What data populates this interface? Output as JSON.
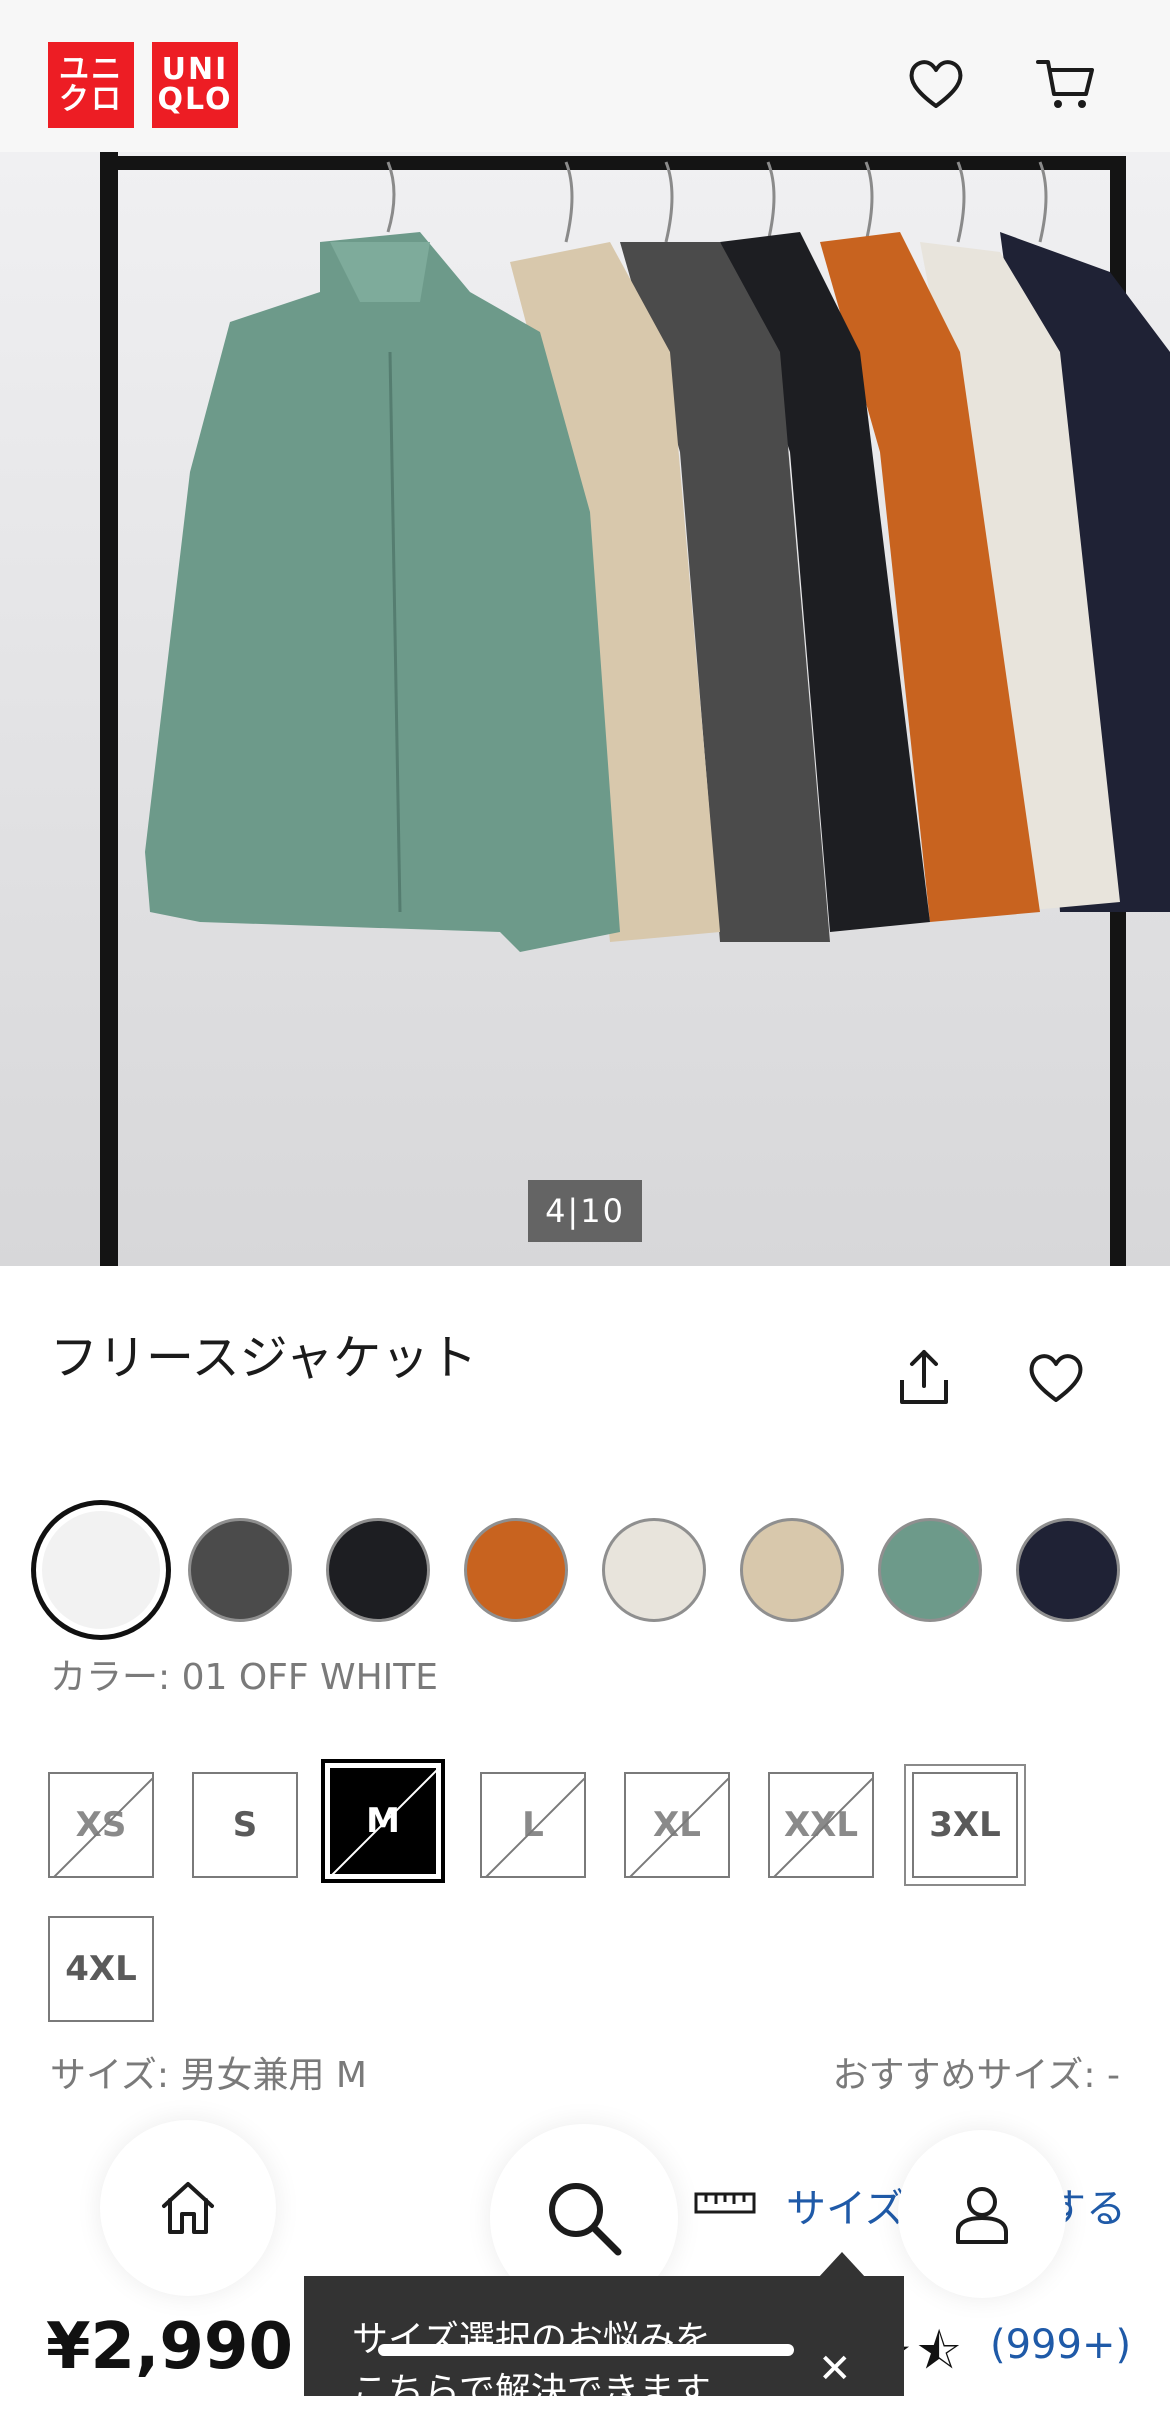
{
  "header": {
    "logo_jp_line1": "ユニ",
    "logo_jp_line2": "クロ",
    "logo_en_line1": "UNI",
    "logo_en_line2": "QLO",
    "icons": [
      "heart-icon",
      "cart-icon"
    ]
  },
  "gallery": {
    "counter": "4|10"
  },
  "product": {
    "title": "フリースジャケット",
    "icons": [
      "share-icon",
      "favorite-icon"
    ]
  },
  "colors": {
    "swatches": [
      "#f2f2f2",
      "#4b4b4b",
      "#1d1e22",
      "#c8631f",
      "#e8e4dc",
      "#d8c8ac",
      "#6d9a8a",
      "#1f2235"
    ],
    "label": "カラー: 01 OFF WHITE"
  },
  "sizes": {
    "options": [
      "XS",
      "S",
      "M",
      "L",
      "XL",
      "XXL",
      "3XL",
      "4XL"
    ],
    "selected_label": "サイズ: 男女兼用 M",
    "recommended_label": "おすすめサイズ: -"
  },
  "size_guide": {
    "label_start": "サイズ",
    "label_end": "する"
  },
  "price": "¥2,990",
  "rating": {
    "stars": "★★★★⯪",
    "count": "(999+)"
  },
  "tooltip": {
    "line1": "サイズ選択のお悩みを",
    "line2": "こちらで解決できます",
    "close": "✕"
  },
  "nav": {
    "icons": [
      "home-icon",
      "search-icon",
      "account-icon"
    ]
  }
}
